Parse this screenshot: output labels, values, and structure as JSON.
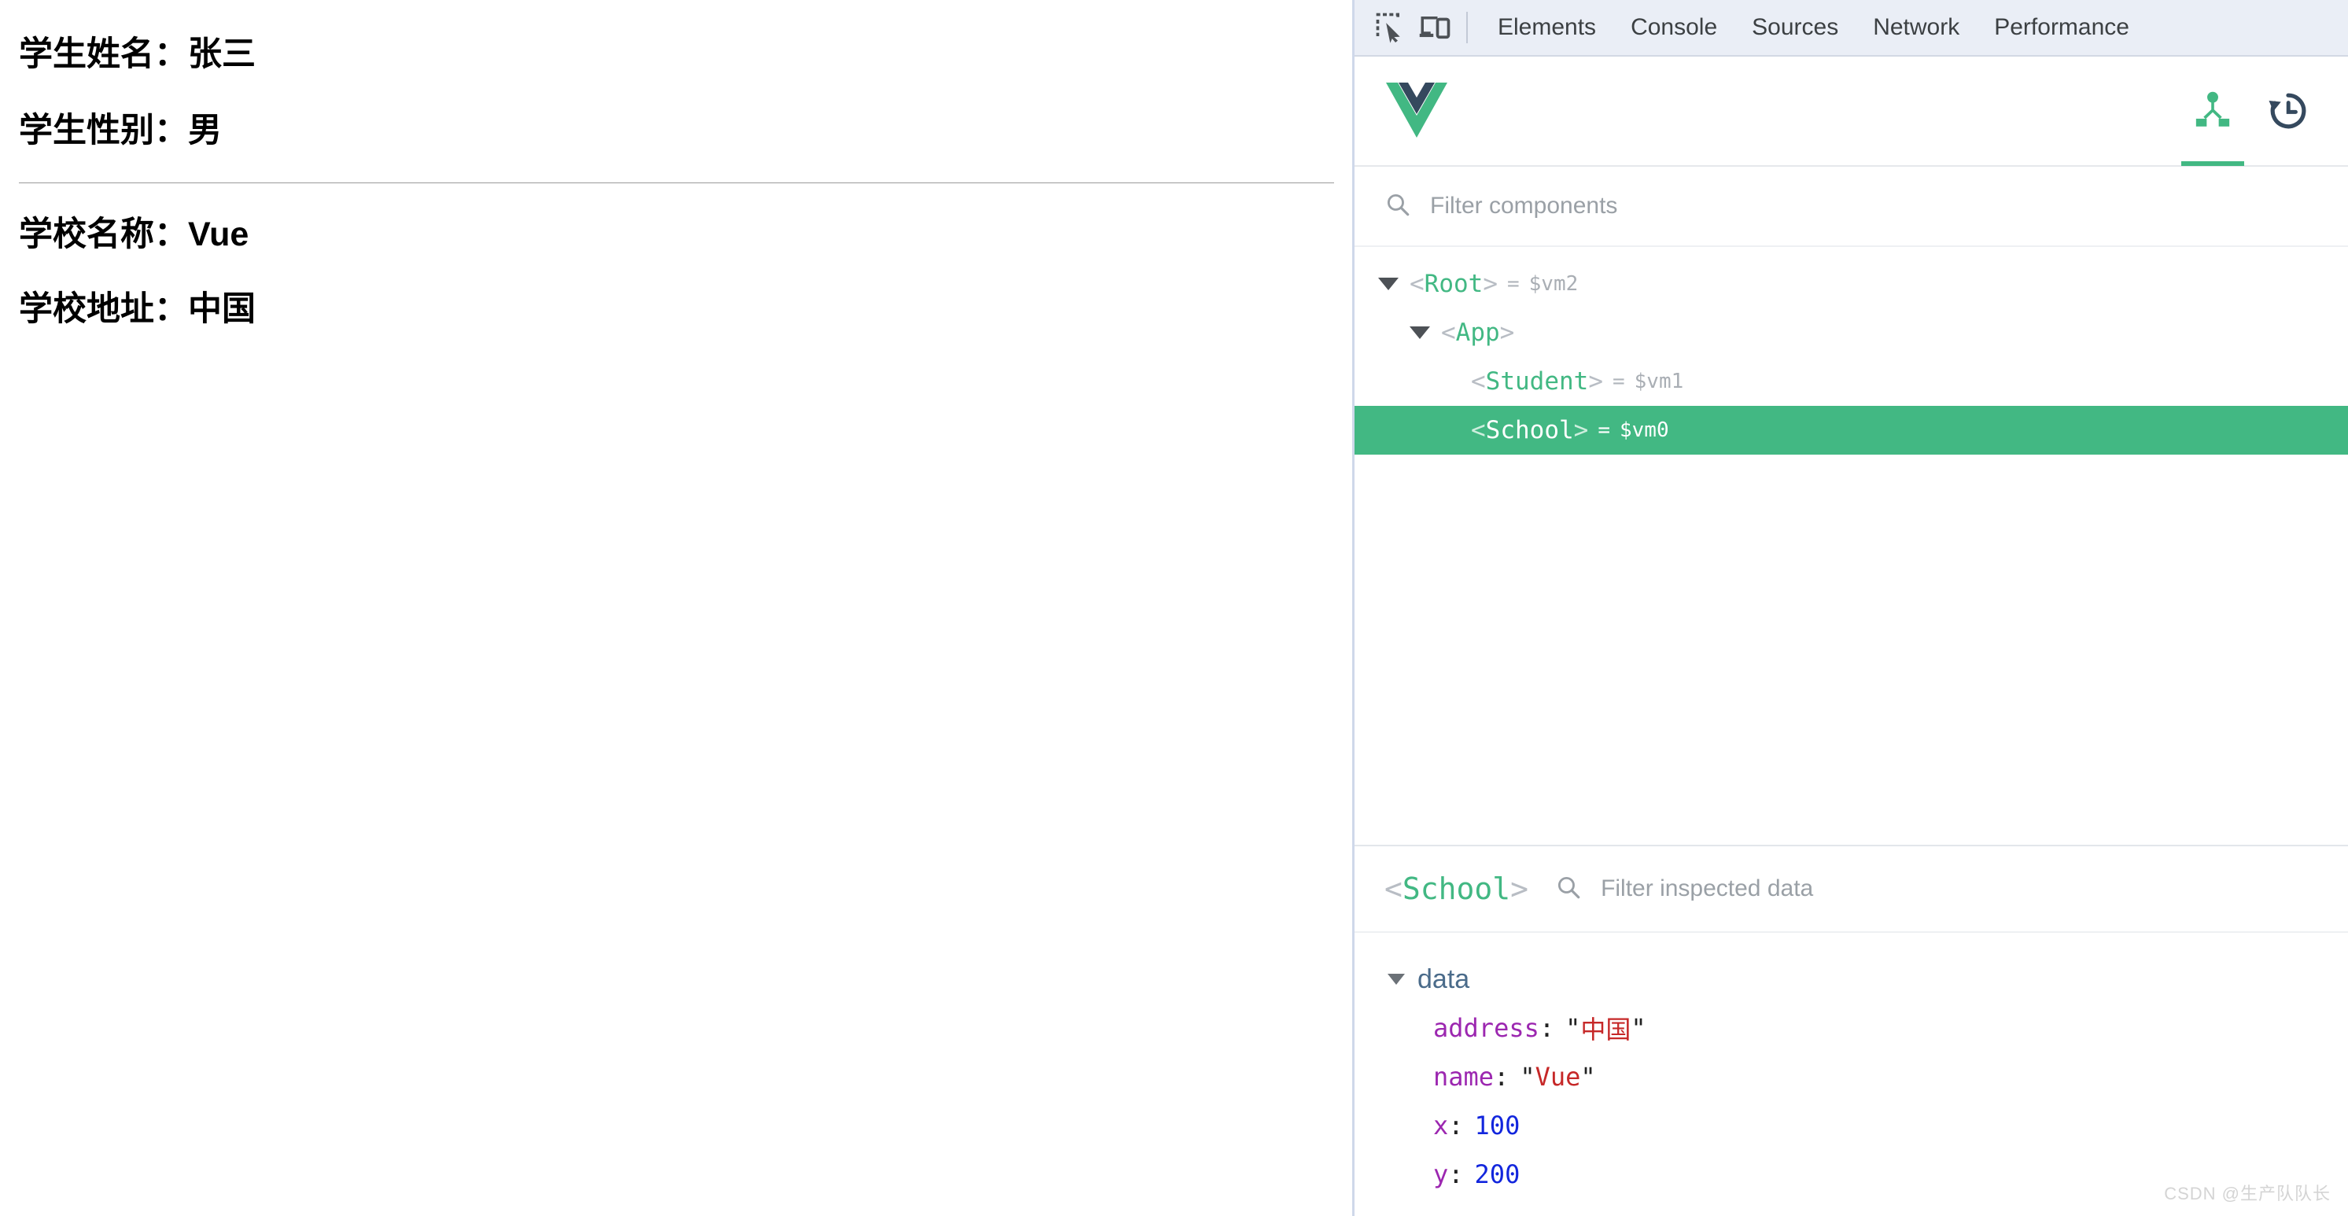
{
  "page": {
    "student": [
      {
        "label": "学生姓名：",
        "value": "张三"
      },
      {
        "label": "学生性别：",
        "value": "男"
      }
    ],
    "school": [
      {
        "label": "学校名称：",
        "value": "Vue"
      },
      {
        "label": "学校地址：",
        "value": "中国"
      }
    ]
  },
  "devtools": {
    "toolbar": {
      "inspect_icon": "inspect-element-icon",
      "device_icon": "device-toolbar-icon",
      "tabs": [
        {
          "label": "Elements",
          "active": false
        },
        {
          "label": "Console",
          "active": false
        },
        {
          "label": "Sources",
          "active": false
        },
        {
          "label": "Network",
          "active": false
        },
        {
          "label": "Performance",
          "active": false
        }
      ]
    },
    "vue_panel": {
      "logo": "vue-logo",
      "tools": [
        {
          "icon": "component-tree-icon",
          "active": true
        },
        {
          "icon": "timeline-history-icon",
          "active": false
        }
      ],
      "filter_components": {
        "icon": "search-icon",
        "placeholder": "Filter components",
        "value": ""
      },
      "tree": [
        {
          "name": "Root",
          "vm": "$vm2",
          "depth": 0,
          "caret": "open",
          "selected": false,
          "eq": "="
        },
        {
          "name": "App",
          "vm": "",
          "depth": 1,
          "caret": "open",
          "selected": false,
          "eq": ""
        },
        {
          "name": "Student",
          "vm": "$vm1",
          "depth": 2,
          "caret": "none",
          "selected": false,
          "eq": "="
        },
        {
          "name": "School",
          "vm": "$vm0",
          "depth": 2,
          "caret": "none",
          "selected": true,
          "eq": "="
        }
      ],
      "inspector": {
        "component": "School",
        "filter_icon": "search-icon",
        "filter_placeholder": "Filter inspected data",
        "filter_value": "",
        "group_label": "data",
        "props": [
          {
            "key": "address",
            "value": "中国",
            "type": "string"
          },
          {
            "key": "name",
            "value": "Vue",
            "type": "string"
          },
          {
            "key": "x",
            "value": "100",
            "type": "number"
          },
          {
            "key": "y",
            "value": "200",
            "type": "number"
          }
        ]
      }
    }
  },
  "watermark": "CSDN @生产队队长",
  "colors": {
    "vue_green": "#42b883",
    "vue_dark": "#35495e",
    "selection_green": "#42b883",
    "key_purple": "#9c27b0",
    "string_red": "#c62828",
    "number_blue": "#1226dd"
  }
}
